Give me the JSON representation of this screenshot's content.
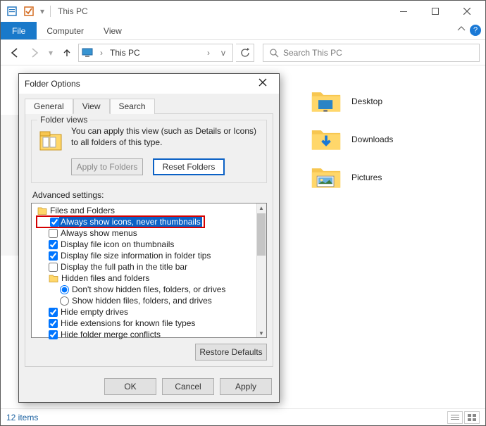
{
  "window": {
    "title": "This PC",
    "minimize_tip": "Minimize",
    "maximize_tip": "Maximize",
    "close_tip": "Close"
  },
  "ribbon": {
    "file": "File",
    "tabs": [
      "Computer",
      "View"
    ]
  },
  "nav": {
    "back_tip": "Back",
    "forward_tip": "Forward",
    "recent_tip": "Recent locations",
    "up_tip": "Up",
    "address_text": "This PC",
    "crumb": "›",
    "refresh_tip": "Refresh",
    "search_placeholder": "Search This PC"
  },
  "folders": [
    {
      "label": "Desktop",
      "icon": "desktop"
    },
    {
      "label": "Downloads",
      "icon": "downloads"
    },
    {
      "label": "Pictures",
      "icon": "pictures"
    }
  ],
  "status": {
    "item_count": "12 items"
  },
  "dialog": {
    "title": "Folder Options",
    "tabs": {
      "general": "General",
      "view": "View",
      "search": "Search"
    },
    "active_tab": "view",
    "folder_views": {
      "group_title": "Folder views",
      "desc": "You can apply this view (such as Details or Icons) to all folders of this type.",
      "apply_btn": "Apply to Folders",
      "reset_btn": "Reset Folders"
    },
    "advanced_label": "Advanced settings:",
    "tree": {
      "root": "Files and Folders",
      "items": [
        {
          "type": "checkbox",
          "checked": true,
          "highlight": true,
          "label": "Always show icons, never thumbnails"
        },
        {
          "type": "checkbox",
          "checked": false,
          "label": "Always show menus"
        },
        {
          "type": "checkbox",
          "checked": true,
          "label": "Display file icon on thumbnails"
        },
        {
          "type": "checkbox",
          "checked": true,
          "label": "Display file size information in folder tips"
        },
        {
          "type": "checkbox",
          "checked": false,
          "label": "Display the full path in the title bar"
        },
        {
          "type": "folder",
          "label": "Hidden files and folders"
        },
        {
          "type": "radio",
          "checked": true,
          "indent": 3,
          "label": "Don't show hidden files, folders, or drives"
        },
        {
          "type": "radio",
          "checked": false,
          "indent": 3,
          "label": "Show hidden files, folders, and drives"
        },
        {
          "type": "checkbox",
          "checked": true,
          "label": "Hide empty drives"
        },
        {
          "type": "checkbox",
          "checked": true,
          "label": "Hide extensions for known file types"
        },
        {
          "type": "checkbox",
          "checked": true,
          "label": "Hide folder merge conflicts"
        }
      ]
    },
    "restore_btn": "Restore Defaults",
    "footer": {
      "ok": "OK",
      "cancel": "Cancel",
      "apply": "Apply"
    }
  }
}
